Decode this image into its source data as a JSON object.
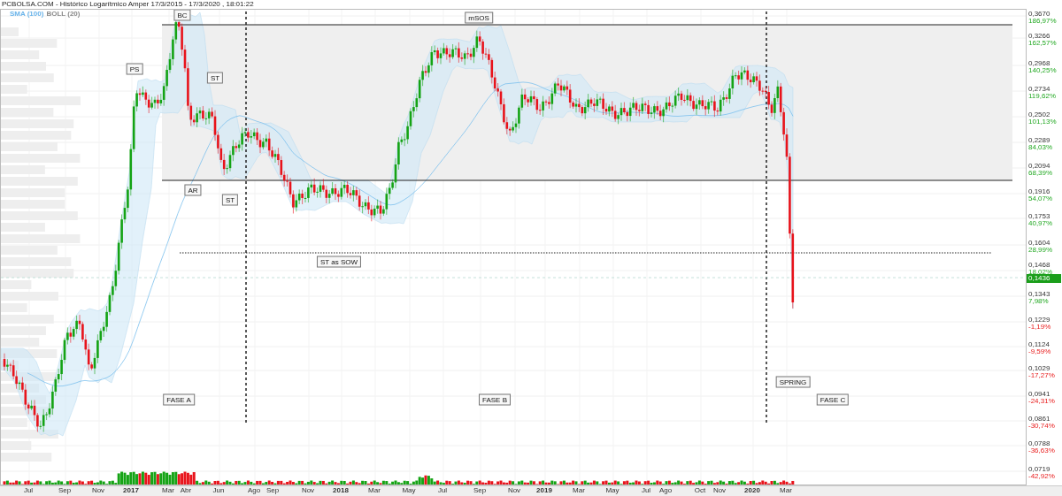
{
  "header": {
    "title": "PCBOLSA.COM - Histórico Logarítmico Amper 17/3/2015 - 17/3/2020 , 18:01:22",
    "indicators": [
      {
        "label": "SMA (100)",
        "color": "#6ab4ea"
      },
      {
        "label": "BOLL (20)",
        "color": "#8a8a8a"
      }
    ]
  },
  "chart": {
    "annotations": [
      {
        "label": "BC"
      },
      {
        "label": "PS"
      },
      {
        "label": "ST"
      },
      {
        "label": "AR"
      },
      {
        "label": "ST"
      },
      {
        "label": "mSOS"
      },
      {
        "label": "ST as SOW"
      },
      {
        "label": "SPRING"
      },
      {
        "label": "FASE A"
      },
      {
        "label": "FASE B"
      },
      {
        "label": "FASE C"
      }
    ],
    "price_axis": [
      {
        "price": "0,3670",
        "change": "186,97%",
        "kind": "gain"
      },
      {
        "price": "0,3266",
        "change": "162,57%",
        "kind": "gain"
      },
      {
        "price": "0,2968",
        "change": "140,25%",
        "kind": "gain"
      },
      {
        "price": "0,2734",
        "change": "119,62%",
        "kind": "gain"
      },
      {
        "price": "0,2502",
        "change": "101,13%",
        "kind": "gain"
      },
      {
        "price": "0,2289",
        "change": "84,03%",
        "kind": "gain"
      },
      {
        "price": "0,2094",
        "change": "68,39%",
        "kind": "gain"
      },
      {
        "price": "0,1916",
        "change": "54,07%",
        "kind": "gain"
      },
      {
        "price": "0,1753",
        "change": "40,97%",
        "kind": "gain"
      },
      {
        "price": "0,1604",
        "change": "28,99%",
        "kind": "gain"
      },
      {
        "price": "0,1468",
        "change": "18,02%",
        "kind": "gain"
      },
      {
        "price": "0,1343",
        "change": "7,98%",
        "kind": "gain"
      },
      {
        "price": "0,1229",
        "change": "-1,19%",
        "kind": "loss"
      },
      {
        "price": "0,1124",
        "change": "-9,59%",
        "kind": "loss"
      },
      {
        "price": "0,1029",
        "change": "-17,27%",
        "kind": "loss"
      },
      {
        "price": "0,0941",
        "change": "-24,31%",
        "kind": "loss"
      },
      {
        "price": "0,0861",
        "change": "-30,74%",
        "kind": "loss"
      },
      {
        "price": "0,0788",
        "change": "-36,63%",
        "kind": "loss"
      },
      {
        "price": "0,0719",
        "change": "-42,92%",
        "kind": "loss"
      }
    ],
    "current_price": "0,1436",
    "time_axis": [
      {
        "label": "Jul",
        "kind": "month"
      },
      {
        "label": "Sep",
        "kind": "month"
      },
      {
        "label": "Nov",
        "kind": "month"
      },
      {
        "label": "2017",
        "kind": "year"
      },
      {
        "label": "Mar",
        "kind": "month"
      },
      {
        "label": "Abr",
        "kind": "month"
      },
      {
        "label": "Jun",
        "kind": "month"
      },
      {
        "label": "Ago",
        "kind": "month"
      },
      {
        "label": "Sep",
        "kind": "month"
      },
      {
        "label": "Nov",
        "kind": "month"
      },
      {
        "label": "2018",
        "kind": "year"
      },
      {
        "label": "Mar",
        "kind": "month"
      },
      {
        "label": "May",
        "kind": "month"
      },
      {
        "label": "Jul",
        "kind": "month"
      },
      {
        "label": "Sep",
        "kind": "month"
      },
      {
        "label": "Nov",
        "kind": "month"
      },
      {
        "label": "2019",
        "kind": "year"
      },
      {
        "label": "Mar",
        "kind": "month"
      },
      {
        "label": "May",
        "kind": "month"
      },
      {
        "label": "Jul",
        "kind": "month"
      },
      {
        "label": "Ago",
        "kind": "month"
      },
      {
        "label": "Oct",
        "kind": "month"
      },
      {
        "label": "Nov",
        "kind": "month"
      },
      {
        "label": "2020",
        "kind": "year"
      },
      {
        "label": "Mar",
        "kind": "month"
      }
    ]
  }
}
